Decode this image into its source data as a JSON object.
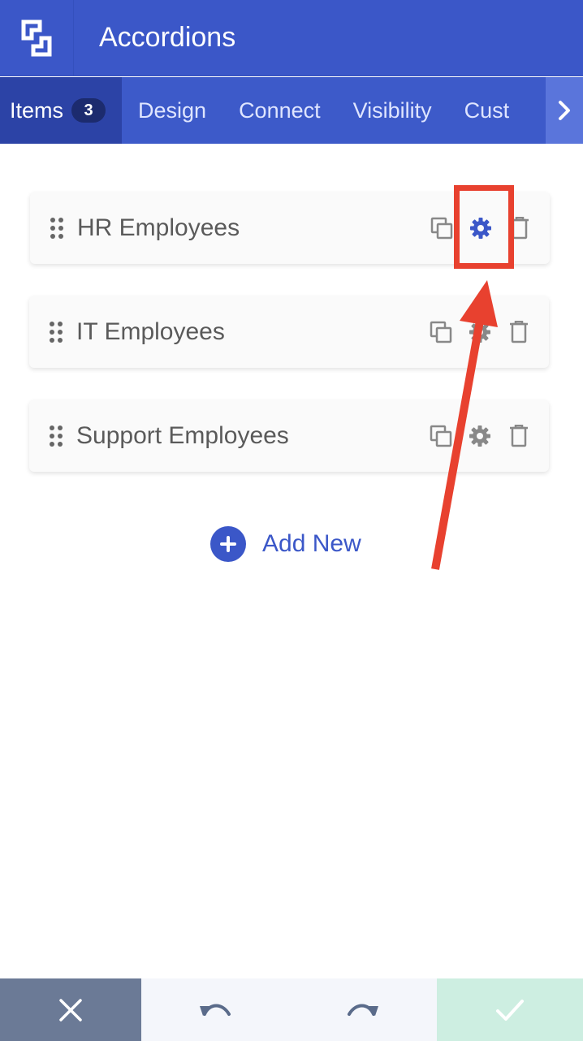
{
  "app": {
    "title": "Accordions",
    "logo_icon": "builder-logo-icon"
  },
  "tabs": [
    {
      "label": "Items",
      "badge": "3",
      "active": true
    },
    {
      "label": "Design"
    },
    {
      "label": "Connect"
    },
    {
      "label": "Visibility"
    },
    {
      "label": "Cust"
    }
  ],
  "items": [
    {
      "label": "HR Employees",
      "settings_active": true
    },
    {
      "label": "IT Employees"
    },
    {
      "label": "Support Employees"
    }
  ],
  "add_new": {
    "label": "Add New"
  },
  "footer": {
    "cancel_icon": "close-icon",
    "undo_icon": "undo-icon",
    "redo_icon": "redo-icon",
    "save_icon": "check-icon"
  },
  "colors": {
    "primary": "#3b57c8",
    "tab_active": "#2c43a6",
    "annotation": "#e8412f",
    "cancel_bg": "#6b7a96",
    "save_bg": "#cdeee1"
  }
}
